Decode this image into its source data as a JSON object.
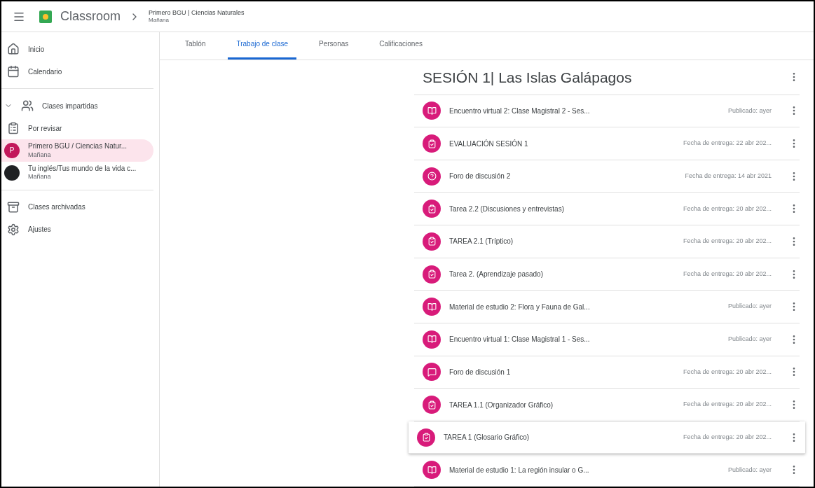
{
  "header": {
    "app_name": "Classroom",
    "class_name": "Primero BGU | Ciencias Naturales",
    "section": "Mañana"
  },
  "sidebar": {
    "items": [
      {
        "kind": "home",
        "label": "Inicio",
        "selected": false
      },
      {
        "kind": "calendar",
        "label": "Calendario",
        "selected": false
      },
      {
        "kind": "divider"
      },
      {
        "kind": "group",
        "label": "Clases impartidas",
        "expanded": true,
        "selected": false
      },
      {
        "kind": "review",
        "label": "Por revisar",
        "selected": false
      },
      {
        "kind": "class",
        "label": "Primero BGU / Ciencias Natur...",
        "sublabel": "Mañana",
        "avatar_letter": "P",
        "color": "#c2185b",
        "selected": true
      },
      {
        "kind": "class",
        "label": "Tu inglés/Tus mundo de la vida c...",
        "sublabel": "Mañana",
        "color": "#202124",
        "selected": false
      },
      {
        "kind": "divider"
      },
      {
        "kind": "archive",
        "label": "Clases archivadas",
        "selected": false
      },
      {
        "kind": "settings",
        "label": "Ajustes",
        "selected": false
      }
    ]
  },
  "tabs": [
    {
      "label": "Tablón",
      "selected": false
    },
    {
      "label": "Trabajo de clase",
      "selected": true
    },
    {
      "label": "Personas",
      "selected": false
    },
    {
      "label": "Calificaciones",
      "selected": false
    }
  ],
  "topic": {
    "title": "SESIÓN 1| Las Islas Galápagos",
    "items": [
      {
        "kind": "material",
        "title": "Encuentro virtual 2: Clase Magistral 2 - Ses...",
        "meta": "Publicado: ayer",
        "hovered": false
      },
      {
        "kind": "assignment",
        "title": "EVALUACIÓN SESIÓN 1",
        "meta": "Fecha de entrega: 22 abr 202...",
        "hovered": false
      },
      {
        "kind": "question",
        "title": "Foro de discusión 2",
        "meta": "Fecha de entrega: 14 abr 2021",
        "hovered": false
      },
      {
        "kind": "assignment",
        "title": "Tarea 2.2 (Discusiones y entrevistas)",
        "meta": "Fecha de entrega: 20 abr 202...",
        "hovered": false
      },
      {
        "kind": "assignment",
        "title": "TAREA 2.1 (Tríptico)",
        "meta": "Fecha de entrega: 20 abr 202...",
        "hovered": false
      },
      {
        "kind": "assignment",
        "title": "Tarea 2. (Aprendizaje pasado)",
        "meta": "Fecha de entrega: 20 abr 202...",
        "hovered": false
      },
      {
        "kind": "material",
        "title": "Material de estudio 2: Flora y Fauna de Gal...",
        "meta": "Publicado: ayer",
        "hovered": false
      },
      {
        "kind": "material",
        "title": "Encuentro virtual 1: Clase Magistral 1 - Ses...",
        "meta": "Publicado: ayer",
        "hovered": false
      },
      {
        "kind": "discussion",
        "title": "Foro de discusión 1",
        "meta": "Fecha de entrega: 20 abr 202...",
        "hovered": false
      },
      {
        "kind": "assignment",
        "title": "TAREA 1.1 (Organizador Gráfico)",
        "meta": "Fecha de entrega: 20 abr 202...",
        "hovered": false
      },
      {
        "kind": "assignment",
        "title": "TAREA 1 (Glosario Gráfico)",
        "meta": "Fecha de entrega: 20 abr 202...",
        "hovered": true
      },
      {
        "kind": "material",
        "title": "Material de estudio 1: La región insular o G...",
        "meta": "Publicado: ayer",
        "hovered": false
      }
    ]
  }
}
